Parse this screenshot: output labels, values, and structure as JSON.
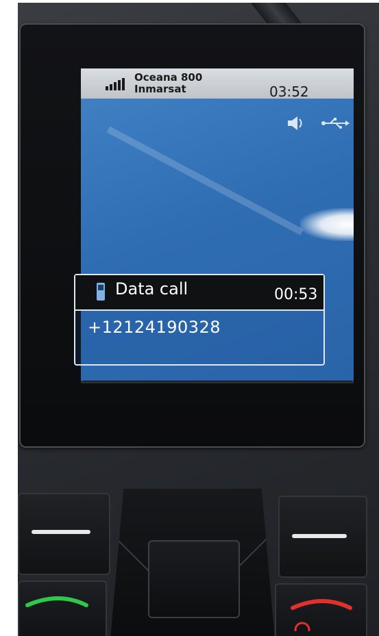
{
  "status_bar": {
    "network_name": "Oceana 800",
    "provider": "Inmarsat",
    "time": "03:52"
  },
  "icons": {
    "signal": "signal-strength-icon",
    "speaker": "speaker-icon",
    "usb": "usb-icon",
    "phone": "phone-handset-icon"
  },
  "call_panel": {
    "label": "Data call",
    "duration": "00:53",
    "number": "+12124190328"
  },
  "colors": {
    "screen_blue": "#2f6db3",
    "call_green": "#2fc94a",
    "end_red": "#e0312b"
  }
}
